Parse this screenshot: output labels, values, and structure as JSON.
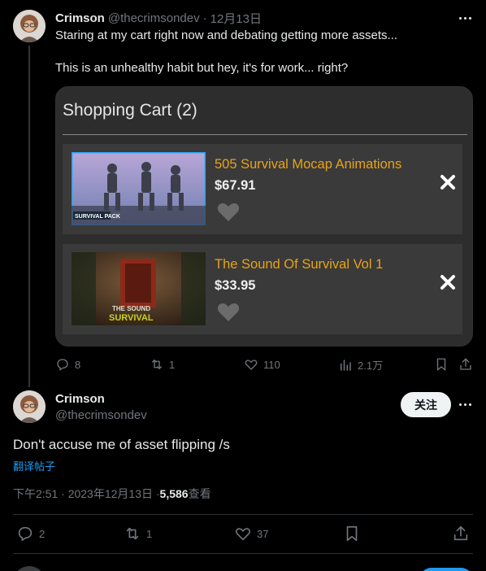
{
  "post1": {
    "name": "Crimson",
    "handle": "@thecrimsondev",
    "separator": "·",
    "date": "12月13日",
    "line1": "Staring at my cart right now and debating getting more assets...",
    "line2": "This is an unhealthy habit but hey, it's for work... right?",
    "card": {
      "title": "Shopping Cart (2)",
      "items": [
        {
          "title": "505 Survival Mocap Animations",
          "price": "$67.91",
          "thumb_label": "SURVIVAL PACK"
        },
        {
          "title": "The Sound Of Survival Vol 1",
          "price": "$33.95",
          "thumb_label1": "THE SOUND",
          "thumb_label2": "SURVIVAL"
        }
      ]
    },
    "actions": {
      "replies": "8",
      "reposts": "1",
      "likes": "110",
      "views": "2.1万"
    }
  },
  "post2": {
    "name": "Crimson",
    "handle": "@thecrimsondev",
    "follow_label": "关注",
    "text": "Don't accuse me of asset flipping /s",
    "translate": "翻译帖子",
    "meta_time": "下午2:51 · 2023年12月13日 · ",
    "meta_views": "5,586",
    "meta_views_label": " 查看",
    "actions": {
      "replies": "2",
      "reposts": "1",
      "likes": "37"
    }
  },
  "colors": {
    "accent": "#1d9bf0",
    "item_title": "#e8a317",
    "muted": "#71767b"
  }
}
